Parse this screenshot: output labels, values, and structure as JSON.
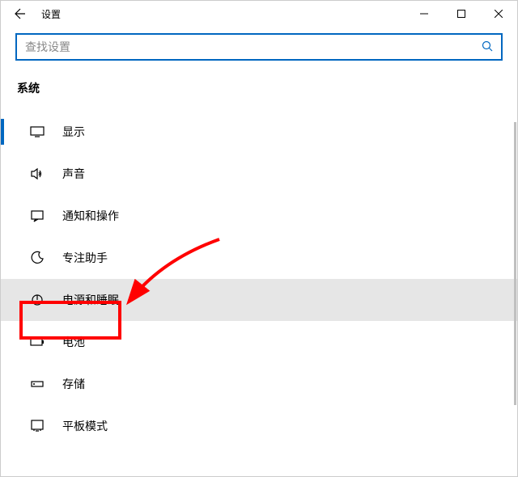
{
  "window": {
    "title": "设置"
  },
  "search": {
    "placeholder": "查找设置"
  },
  "category": {
    "label": "系统"
  },
  "nav": {
    "items": [
      {
        "icon": "display-icon",
        "label": "显示"
      },
      {
        "icon": "sound-icon",
        "label": "声音"
      },
      {
        "icon": "notifications-icon",
        "label": "通知和操作"
      },
      {
        "icon": "focus-icon",
        "label": "专注助手"
      },
      {
        "icon": "power-icon",
        "label": "电源和睡眠"
      },
      {
        "icon": "battery-icon",
        "label": "电池"
      },
      {
        "icon": "storage-icon",
        "label": "存储"
      },
      {
        "icon": "tablet-icon",
        "label": "平板模式"
      }
    ]
  },
  "annotation": {
    "highlight_index": 4,
    "color": "#ff0000"
  }
}
